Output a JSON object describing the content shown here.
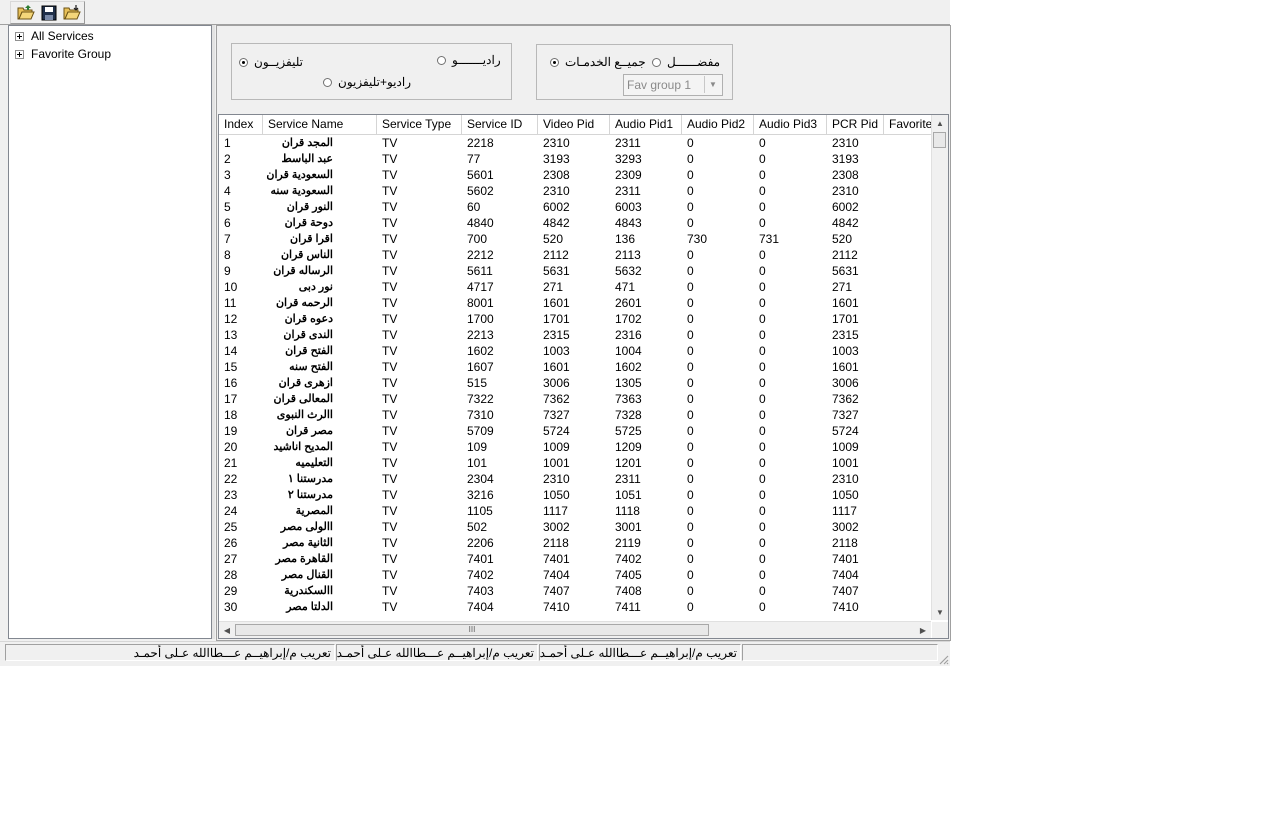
{
  "toolbar": {
    "buttons": [
      {
        "name": "open-folder-icon"
      },
      {
        "name": "save-disk-icon"
      },
      {
        "name": "export-folder-icon"
      }
    ]
  },
  "tree": {
    "items": [
      {
        "label": "All Services"
      },
      {
        "label": "Favorite Group"
      }
    ]
  },
  "filter_type": {
    "tv_label": "تليفزيــون",
    "radio_label": "راديـــــــو",
    "radio_tv_label": "راديو+تليفزيون",
    "selected": "tv"
  },
  "filter_group": {
    "all_label": "جميــع الخدمـات",
    "fav_label": "مفضــــــل",
    "selected": "all",
    "fav_group_value": "Fav group 1"
  },
  "table": {
    "columns": [
      "Index",
      "Service Name",
      "Service Type",
      "Service ID",
      "Video Pid",
      "Audio Pid1",
      "Audio Pid2",
      "Audio Pid3",
      "PCR Pid",
      "Favorite"
    ],
    "rows": [
      [
        "1",
        "المجد قران",
        "TV",
        "2218",
        "2310",
        "2311",
        "0",
        "0",
        "2310",
        ""
      ],
      [
        "2",
        "عبد الباسط",
        "TV",
        "77",
        "3193",
        "3293",
        "0",
        "0",
        "3193",
        ""
      ],
      [
        "3",
        "السعودية قران",
        "TV",
        "5601",
        "2308",
        "2309",
        "0",
        "0",
        "2308",
        ""
      ],
      [
        "4",
        "السعودية سنه",
        "TV",
        "5602",
        "2310",
        "2311",
        "0",
        "0",
        "2310",
        ""
      ],
      [
        "5",
        "النور قران",
        "TV",
        "60",
        "6002",
        "6003",
        "0",
        "0",
        "6002",
        ""
      ],
      [
        "6",
        "دوحة قران",
        "TV",
        "4840",
        "4842",
        "4843",
        "0",
        "0",
        "4842",
        ""
      ],
      [
        "7",
        "اقرا قران",
        "TV",
        "700",
        "520",
        "136",
        "730",
        "731",
        "520",
        ""
      ],
      [
        "8",
        "الناس قران",
        "TV",
        "2212",
        "2112",
        "2113",
        "0",
        "0",
        "2112",
        ""
      ],
      [
        "9",
        "الرساله قران",
        "TV",
        "5611",
        "5631",
        "5632",
        "0",
        "0",
        "5631",
        ""
      ],
      [
        "10",
        "نور دبى",
        "TV",
        "4717",
        "271",
        "471",
        "0",
        "0",
        "271",
        ""
      ],
      [
        "11",
        "الرحمه قران",
        "TV",
        "8001",
        "1601",
        "2601",
        "0",
        "0",
        "1601",
        ""
      ],
      [
        "12",
        "دعوه قران",
        "TV",
        "1700",
        "1701",
        "1702",
        "0",
        "0",
        "1701",
        ""
      ],
      [
        "13",
        "الندى قران",
        "TV",
        "2213",
        "2315",
        "2316",
        "0",
        "0",
        "2315",
        ""
      ],
      [
        "14",
        "الفتح قران",
        "TV",
        "1602",
        "1003",
        "1004",
        "0",
        "0",
        "1003",
        ""
      ],
      [
        "15",
        "الفتح سنه",
        "TV",
        "1607",
        "1601",
        "1602",
        "0",
        "0",
        "1601",
        ""
      ],
      [
        "16",
        "ازهرى قران",
        "TV",
        "515",
        "3006",
        "1305",
        "0",
        "0",
        "3006",
        ""
      ],
      [
        "17",
        "المعالى قران",
        "TV",
        "7322",
        "7362",
        "7363",
        "0",
        "0",
        "7362",
        ""
      ],
      [
        "18",
        "االرث النبوى",
        "TV",
        "7310",
        "7327",
        "7328",
        "0",
        "0",
        "7327",
        ""
      ],
      [
        "19",
        "مصر قران",
        "TV",
        "5709",
        "5724",
        "5725",
        "0",
        "0",
        "5724",
        ""
      ],
      [
        "20",
        "المديح اناشيد",
        "TV",
        "109",
        "1009",
        "1209",
        "0",
        "0",
        "1009",
        ""
      ],
      [
        "21",
        "التعليميه",
        "TV",
        "101",
        "1001",
        "1201",
        "0",
        "0",
        "1001",
        ""
      ],
      [
        "22",
        "مدرستنا ١",
        "TV",
        "2304",
        "2310",
        "2311",
        "0",
        "0",
        "2310",
        ""
      ],
      [
        "23",
        "مدرستنا ٢",
        "TV",
        "3216",
        "1050",
        "1051",
        "0",
        "0",
        "1050",
        ""
      ],
      [
        "24",
        "المصرية",
        "TV",
        "1105",
        "1117",
        "1118",
        "0",
        "0",
        "1117",
        ""
      ],
      [
        "25",
        "االولى مصر",
        "TV",
        "502",
        "3002",
        "3001",
        "0",
        "0",
        "3002",
        ""
      ],
      [
        "26",
        "الثانية مصر",
        "TV",
        "2206",
        "2118",
        "2119",
        "0",
        "0",
        "2118",
        ""
      ],
      [
        "27",
        "القاهرة مصر",
        "TV",
        "7401",
        "7401",
        "7402",
        "0",
        "0",
        "7401",
        ""
      ],
      [
        "28",
        "القنال مصر",
        "TV",
        "7402",
        "7404",
        "7405",
        "0",
        "0",
        "7404",
        ""
      ],
      [
        "29",
        "االسكندرية",
        "TV",
        "7403",
        "7407",
        "7408",
        "0",
        "0",
        "7407",
        ""
      ],
      [
        "30",
        "الدلتا مصر",
        "TV",
        "7404",
        "7410",
        "7411",
        "0",
        "0",
        "7410",
        ""
      ]
    ]
  },
  "scroll": {
    "h_thumb_grip": "III"
  },
  "status_bar": {
    "panels": [
      "تعريب م/إبراهيــم عـــطاالله عـلى أحمـد",
      "تعريب م/إبراهيــم عـــطاالله عـلى أحمـد",
      "تعريب م/إبراهيــم عـــطاالله عـلى أحمـد",
      ""
    ]
  }
}
